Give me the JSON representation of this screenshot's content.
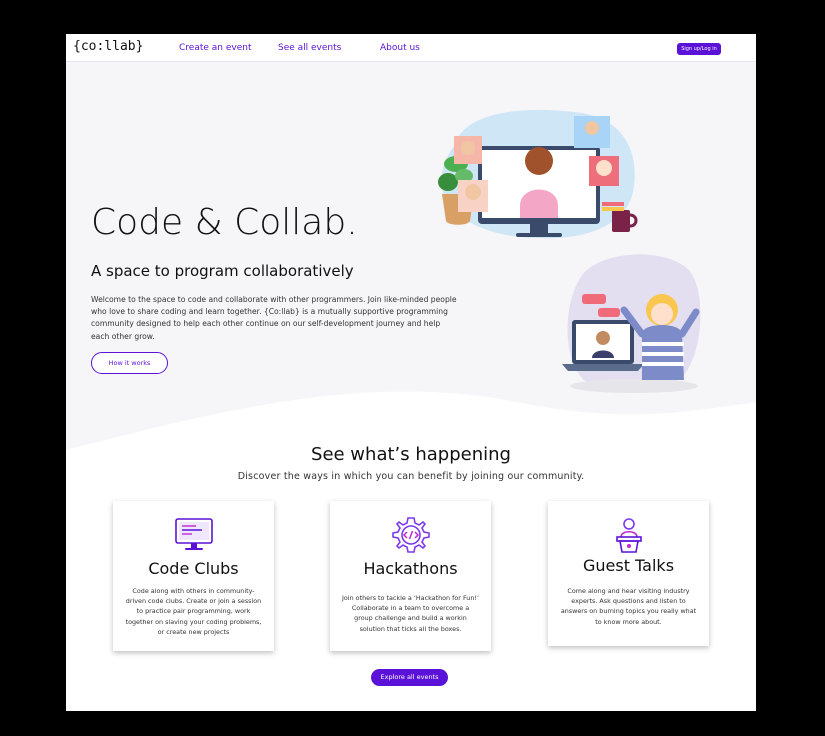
{
  "nav": {
    "logo": "{co:llab}",
    "links": [
      "Create an event",
      "See all events",
      "About us"
    ],
    "signup_label": "Sign up/Log in"
  },
  "hero": {
    "title": "Code & Collab.",
    "subtitle": "A space to program collaboratively",
    "description": "Welcome to the space to code and collaborate with other programmers. Join like-minded people who love to share coding and learn together. {Co:llab} is a mutually supportive programming community designed to help each other continue on our self-development journey and help each other grow.",
    "cta_label": "How it works"
  },
  "section": {
    "title": "See what’s happening",
    "subtitle": "Discover the ways in which you can benefit by joining our community."
  },
  "cards": [
    {
      "title": "Code Clubs",
      "text": "Code along with others in community-driven code clubs. Create or join a session to practice pair programming, work together on slaving your coding problems, or create new projects",
      "icon": "monitor-code-icon"
    },
    {
      "title": "Hackathons",
      "text": "Join others to tackle a ‘Hackathon for Fun!’ Collaborate in a team to overcome a group challenge and build a workin solution that  ticks all the boxes.",
      "icon": "gear-code-icon"
    },
    {
      "title": "Guest Talks",
      "text": "Come along and hear visiting industry experts. Ask questions and listen to answers on burning topics you really what to know more about.",
      "icon": "speaker-podium-icon"
    }
  ],
  "explore_label": "Explore all events",
  "colors": {
    "accent": "#5b12d8",
    "hero_bg": "#f6f6f8",
    "text": "#111111"
  }
}
